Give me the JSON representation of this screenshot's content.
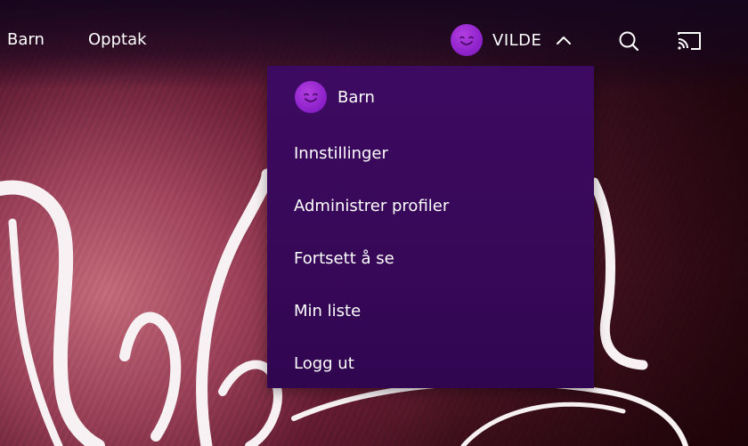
{
  "nav": {
    "links": [
      "Barn",
      "Opptak"
    ]
  },
  "profile": {
    "name": "VILDE",
    "avatar_color": "#9b2ad6"
  },
  "icons": {
    "search": "search-icon",
    "cast": "cast-icon",
    "chevron": "chevron-up-icon"
  },
  "dropdown": {
    "profile_label": "Barn",
    "items": [
      "Innstillinger",
      "Administrer profiler",
      "Fortsett å se",
      "Min liste",
      "Logg ut"
    ]
  },
  "colors": {
    "menu_bg": "#3a0a5e",
    "accent": "#9b2ad6"
  }
}
